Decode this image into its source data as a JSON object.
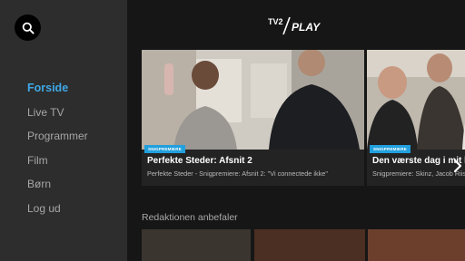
{
  "sidebar": {
    "search_icon": "search-icon",
    "items": [
      {
        "label": "Forside",
        "active": true
      },
      {
        "label": "Live TV"
      },
      {
        "label": "Programmer"
      },
      {
        "label": "Film"
      },
      {
        "label": "Børn"
      },
      {
        "label": "Log ud"
      }
    ]
  },
  "header": {
    "logo_text": "PLAY",
    "logo_mark": "TV2"
  },
  "cards": [
    {
      "badge": "SNIGPREMIERE",
      "title": "Perfekte Steder: Afsnit 2",
      "subtitle": "Perfekte Steder - Snigpremiere: Afsnit 2: \"Vi connectede ikke\""
    },
    {
      "badge": "SNIGPREMIERE",
      "title": "Den værste dag i mit liv",
      "subtitle": "Snigpremiere: Skinz, Jacob Riising"
    }
  ],
  "section": {
    "title": "Redaktionen anbefaler"
  },
  "colors": {
    "accent": "#3ea8e6",
    "badge": "#21a0de",
    "sidebar_bg": "#2d2d2d",
    "main_bg": "#161616"
  }
}
